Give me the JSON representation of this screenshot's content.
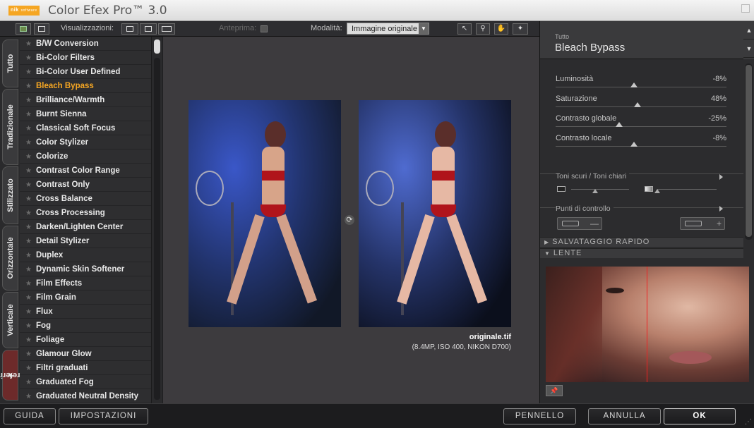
{
  "app": {
    "title": "Color Efex Pro™ 3.0",
    "logo_text": "nik",
    "logo_sub": "software"
  },
  "toolbar": {
    "view_label": "Visualizzazioni:",
    "preview_label": "Anteprima:",
    "mode_label": "Modalità:",
    "mode_value": "Immagine originale"
  },
  "tabs": [
    {
      "label": "Tutto"
    },
    {
      "label": "Tradizionale"
    },
    {
      "label": "Stilizzato"
    },
    {
      "label": "Orizzontale"
    },
    {
      "label": "Verticale"
    },
    {
      "label": "Preferiti"
    }
  ],
  "filters": [
    {
      "label": "B/W Conversion"
    },
    {
      "label": "Bi-Color Filters"
    },
    {
      "label": "Bi-Color User Defined"
    },
    {
      "label": "Bleach Bypass",
      "selected": true
    },
    {
      "label": "Brilliance/Warmth"
    },
    {
      "label": "Burnt Sienna"
    },
    {
      "label": "Classical Soft Focus"
    },
    {
      "label": "Color Stylizer"
    },
    {
      "label": "Colorize"
    },
    {
      "label": "Contrast Color Range"
    },
    {
      "label": "Contrast Only"
    },
    {
      "label": "Cross Balance"
    },
    {
      "label": "Cross Processing"
    },
    {
      "label": "Darken/Lighten Center"
    },
    {
      "label": "Detail Stylizer"
    },
    {
      "label": "Duplex"
    },
    {
      "label": "Dynamic Skin Softener"
    },
    {
      "label": "Film Effects"
    },
    {
      "label": "Film Grain"
    },
    {
      "label": "Flux"
    },
    {
      "label": "Fog"
    },
    {
      "label": "Foliage"
    },
    {
      "label": "Glamour Glow"
    },
    {
      "label": "Filtri graduati"
    },
    {
      "label": "Graduated Fog"
    },
    {
      "label": "Graduated Neutral Density"
    }
  ],
  "preview": {
    "filename": "originale.tif",
    "fileinfo": "(8.4MP, ISO 400, NIKON D700)"
  },
  "panel": {
    "category": "Tutto",
    "title": "Bleach Bypass",
    "sliders": [
      {
        "label": "Luminosità",
        "value": "-8%",
        "pos": 0.46
      },
      {
        "label": "Saturazione",
        "value": "48%",
        "pos": 0.48
      },
      {
        "label": "Contrasto globale",
        "value": "-25%",
        "pos": 0.37
      },
      {
        "label": "Contrasto locale",
        "value": "-8%",
        "pos": 0.46
      }
    ],
    "tones_label": "Toni scuri / Toni chiari",
    "control_points_label": "Punti di controllo",
    "quick_save_label": "SALVATAGGIO RAPIDO",
    "lens_label": "LENTE"
  },
  "bottom": {
    "guide": "GUIDA",
    "settings": "IMPOSTAZIONI",
    "brush": "PENNELLO",
    "cancel": "ANNULLA",
    "ok": "OK"
  },
  "colors": {
    "selected_filter": "#f5a623",
    "background": "#1e1e20"
  }
}
